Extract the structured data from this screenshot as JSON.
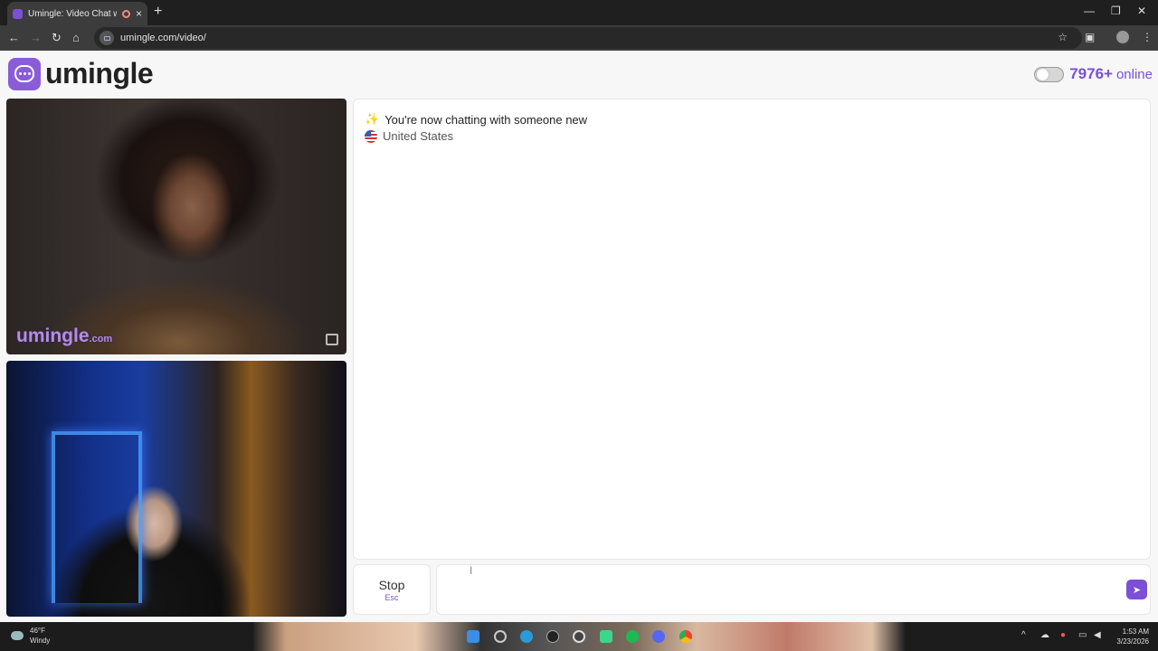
{
  "browser": {
    "tab_title": "Umingle: Video Chat with St",
    "close_glyph": "×",
    "new_tab_glyph": "+",
    "url": "umingle.com/video/",
    "nav": {
      "back": "←",
      "forward": "→",
      "reload": "↻",
      "home": "⌂"
    },
    "star_glyph": "☆",
    "window": {
      "minimize": "—",
      "restore": "❐",
      "close": "✕"
    }
  },
  "header": {
    "logo_text": "umingle",
    "online_count": "7976+",
    "online_label": "online"
  },
  "videos": {
    "watermark_main": "umingle",
    "watermark_tld": ".com"
  },
  "chat": {
    "sparkle": "✨",
    "status_message": "You're now chatting with someone new",
    "country": "United States"
  },
  "controls": {
    "stop_label": "Stop",
    "stop_key": "Esc",
    "input_value": "",
    "input_placeholder": "",
    "send_glyph": "➤",
    "cursor_glyph": "I"
  },
  "taskbar": {
    "temperature": "46°F",
    "condition": "Windy",
    "time": "1:53 AM",
    "date": "3/23/2026",
    "tray_chevron": "^"
  },
  "colors": {
    "brand": "#7b4fd6",
    "logo_mark": "#8a5cd8"
  }
}
